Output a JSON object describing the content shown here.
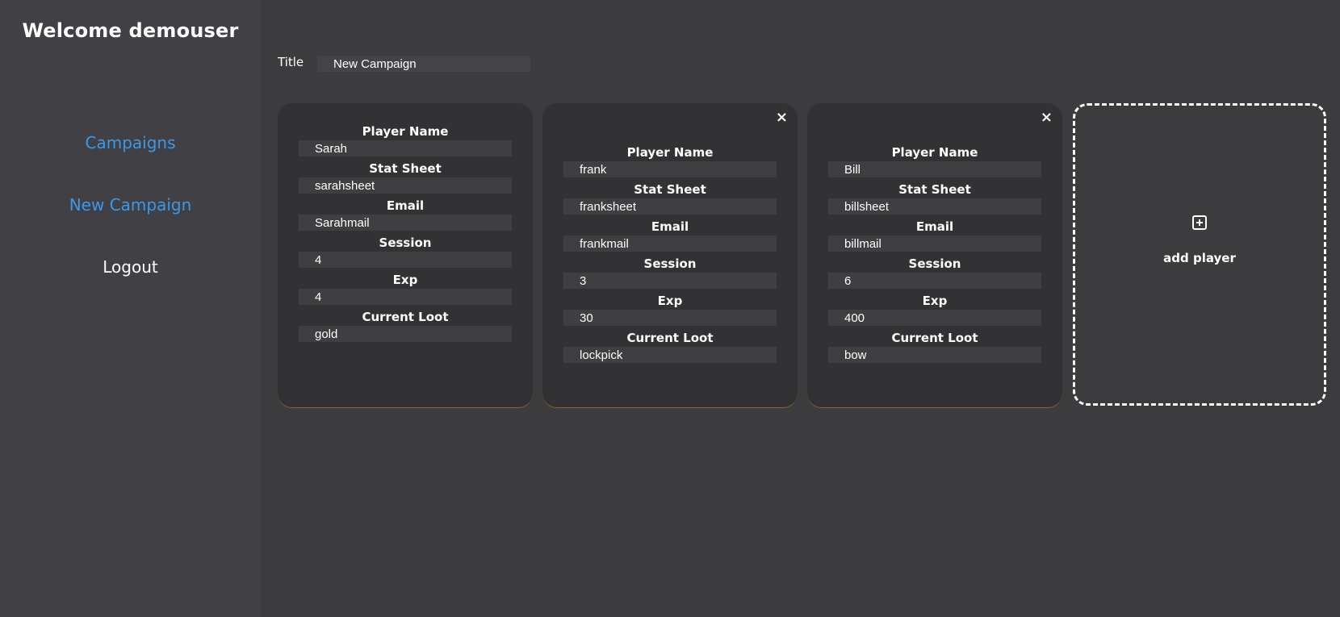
{
  "sidebar": {
    "welcome": "Welcome demouser",
    "nav": [
      {
        "label": "Campaigns"
      },
      {
        "label": "New Campaign"
      },
      {
        "label": "Logout"
      }
    ]
  },
  "campaign": {
    "title_label": "Title",
    "title_value": "New Campaign"
  },
  "field_labels": {
    "player_name": "Player Name",
    "stat_sheet": "Stat Sheet",
    "email": "Email",
    "session": "Session",
    "exp": "Exp",
    "current_loot": "Current Loot"
  },
  "players": [
    {
      "name": "Sarah",
      "stat_sheet": "sarahsheet",
      "email": "Sarahmail",
      "session": "4",
      "exp": "4",
      "current_loot": "gold",
      "removable": false
    },
    {
      "name": "frank",
      "stat_sheet": "franksheet",
      "email": "frankmail",
      "session": "3",
      "exp": "30",
      "current_loot": "lockpick",
      "removable": true
    },
    {
      "name": "Bill",
      "stat_sheet": "billsheet",
      "email": "billmail",
      "session": "6",
      "exp": "400",
      "current_loot": "bow",
      "removable": true
    }
  ],
  "close_glyph": "×",
  "add_player": {
    "icon": "plus-square-icon",
    "label": "add player"
  },
  "colors": {
    "link": "#3a98e8",
    "sidebar_bg": "#414145",
    "main_bg": "#3c3c3f",
    "card_bg": "#323234",
    "card_accent": "#8a6a1a"
  }
}
